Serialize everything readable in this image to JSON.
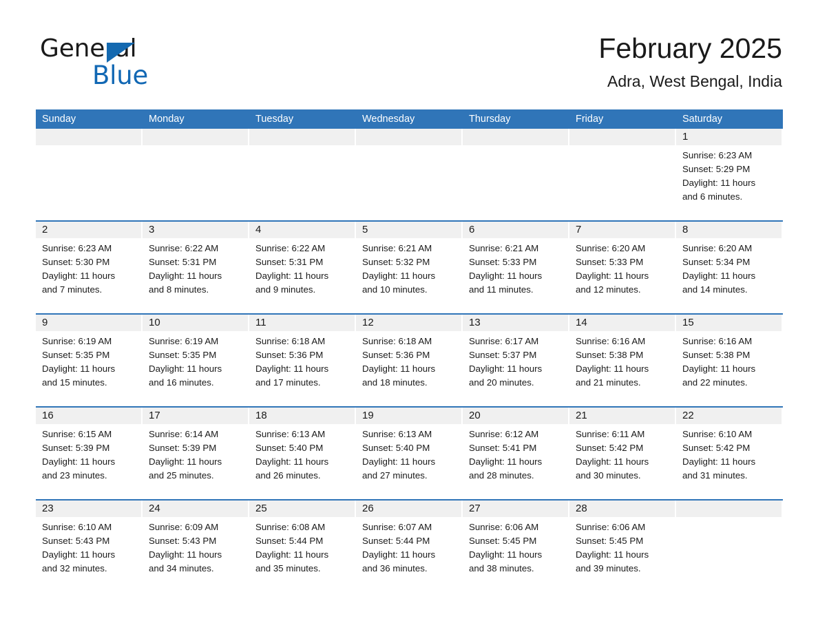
{
  "brand": {
    "name_part1": "General",
    "name_part2": "Blue",
    "accent_color": "#1268b4",
    "triangle_icon": "triangle-icon"
  },
  "header": {
    "title": "February 2025",
    "subtitle": "Adra, West Bengal, India"
  },
  "theme": {
    "header_blue": "#3075b8",
    "date_band_gray": "#f0f0f0",
    "text_color": "#1a1a1a"
  },
  "weekdays": [
    "Sunday",
    "Monday",
    "Tuesday",
    "Wednesday",
    "Thursday",
    "Friday",
    "Saturday"
  ],
  "labels": {
    "sunrise_prefix": "Sunrise:",
    "sunset_prefix": "Sunset:",
    "daylight_prefix": "Daylight:"
  },
  "weeks": [
    [
      {
        "date": "",
        "empty": true
      },
      {
        "date": "",
        "empty": true
      },
      {
        "date": "",
        "empty": true
      },
      {
        "date": "",
        "empty": true
      },
      {
        "date": "",
        "empty": true
      },
      {
        "date": "",
        "empty": true
      },
      {
        "date": "1",
        "sunrise": "Sunrise: 6:23 AM",
        "sunset": "Sunset: 5:29 PM",
        "daylight_line1": "Daylight: 11 hours",
        "daylight_line2": "and 6 minutes."
      }
    ],
    [
      {
        "date": "2",
        "sunrise": "Sunrise: 6:23 AM",
        "sunset": "Sunset: 5:30 PM",
        "daylight_line1": "Daylight: 11 hours",
        "daylight_line2": "and 7 minutes."
      },
      {
        "date": "3",
        "sunrise": "Sunrise: 6:22 AM",
        "sunset": "Sunset: 5:31 PM",
        "daylight_line1": "Daylight: 11 hours",
        "daylight_line2": "and 8 minutes."
      },
      {
        "date": "4",
        "sunrise": "Sunrise: 6:22 AM",
        "sunset": "Sunset: 5:31 PM",
        "daylight_line1": "Daylight: 11 hours",
        "daylight_line2": "and 9 minutes."
      },
      {
        "date": "5",
        "sunrise": "Sunrise: 6:21 AM",
        "sunset": "Sunset: 5:32 PM",
        "daylight_line1": "Daylight: 11 hours",
        "daylight_line2": "and 10 minutes."
      },
      {
        "date": "6",
        "sunrise": "Sunrise: 6:21 AM",
        "sunset": "Sunset: 5:33 PM",
        "daylight_line1": "Daylight: 11 hours",
        "daylight_line2": "and 11 minutes."
      },
      {
        "date": "7",
        "sunrise": "Sunrise: 6:20 AM",
        "sunset": "Sunset: 5:33 PM",
        "daylight_line1": "Daylight: 11 hours",
        "daylight_line2": "and 12 minutes."
      },
      {
        "date": "8",
        "sunrise": "Sunrise: 6:20 AM",
        "sunset": "Sunset: 5:34 PM",
        "daylight_line1": "Daylight: 11 hours",
        "daylight_line2": "and 14 minutes."
      }
    ],
    [
      {
        "date": "9",
        "sunrise": "Sunrise: 6:19 AM",
        "sunset": "Sunset: 5:35 PM",
        "daylight_line1": "Daylight: 11 hours",
        "daylight_line2": "and 15 minutes."
      },
      {
        "date": "10",
        "sunrise": "Sunrise: 6:19 AM",
        "sunset": "Sunset: 5:35 PM",
        "daylight_line1": "Daylight: 11 hours",
        "daylight_line2": "and 16 minutes."
      },
      {
        "date": "11",
        "sunrise": "Sunrise: 6:18 AM",
        "sunset": "Sunset: 5:36 PM",
        "daylight_line1": "Daylight: 11 hours",
        "daylight_line2": "and 17 minutes."
      },
      {
        "date": "12",
        "sunrise": "Sunrise: 6:18 AM",
        "sunset": "Sunset: 5:36 PM",
        "daylight_line1": "Daylight: 11 hours",
        "daylight_line2": "and 18 minutes."
      },
      {
        "date": "13",
        "sunrise": "Sunrise: 6:17 AM",
        "sunset": "Sunset: 5:37 PM",
        "daylight_line1": "Daylight: 11 hours",
        "daylight_line2": "and 20 minutes."
      },
      {
        "date": "14",
        "sunrise": "Sunrise: 6:16 AM",
        "sunset": "Sunset: 5:38 PM",
        "daylight_line1": "Daylight: 11 hours",
        "daylight_line2": "and 21 minutes."
      },
      {
        "date": "15",
        "sunrise": "Sunrise: 6:16 AM",
        "sunset": "Sunset: 5:38 PM",
        "daylight_line1": "Daylight: 11 hours",
        "daylight_line2": "and 22 minutes."
      }
    ],
    [
      {
        "date": "16",
        "sunrise": "Sunrise: 6:15 AM",
        "sunset": "Sunset: 5:39 PM",
        "daylight_line1": "Daylight: 11 hours",
        "daylight_line2": "and 23 minutes."
      },
      {
        "date": "17",
        "sunrise": "Sunrise: 6:14 AM",
        "sunset": "Sunset: 5:39 PM",
        "daylight_line1": "Daylight: 11 hours",
        "daylight_line2": "and 25 minutes."
      },
      {
        "date": "18",
        "sunrise": "Sunrise: 6:13 AM",
        "sunset": "Sunset: 5:40 PM",
        "daylight_line1": "Daylight: 11 hours",
        "daylight_line2": "and 26 minutes."
      },
      {
        "date": "19",
        "sunrise": "Sunrise: 6:13 AM",
        "sunset": "Sunset: 5:40 PM",
        "daylight_line1": "Daylight: 11 hours",
        "daylight_line2": "and 27 minutes."
      },
      {
        "date": "20",
        "sunrise": "Sunrise: 6:12 AM",
        "sunset": "Sunset: 5:41 PM",
        "daylight_line1": "Daylight: 11 hours",
        "daylight_line2": "and 28 minutes."
      },
      {
        "date": "21",
        "sunrise": "Sunrise: 6:11 AM",
        "sunset": "Sunset: 5:42 PM",
        "daylight_line1": "Daylight: 11 hours",
        "daylight_line2": "and 30 minutes."
      },
      {
        "date": "22",
        "sunrise": "Sunrise: 6:10 AM",
        "sunset": "Sunset: 5:42 PM",
        "daylight_line1": "Daylight: 11 hours",
        "daylight_line2": "and 31 minutes."
      }
    ],
    [
      {
        "date": "23",
        "sunrise": "Sunrise: 6:10 AM",
        "sunset": "Sunset: 5:43 PM",
        "daylight_line1": "Daylight: 11 hours",
        "daylight_line2": "and 32 minutes."
      },
      {
        "date": "24",
        "sunrise": "Sunrise: 6:09 AM",
        "sunset": "Sunset: 5:43 PM",
        "daylight_line1": "Daylight: 11 hours",
        "daylight_line2": "and 34 minutes."
      },
      {
        "date": "25",
        "sunrise": "Sunrise: 6:08 AM",
        "sunset": "Sunset: 5:44 PM",
        "daylight_line1": "Daylight: 11 hours",
        "daylight_line2": "and 35 minutes."
      },
      {
        "date": "26",
        "sunrise": "Sunrise: 6:07 AM",
        "sunset": "Sunset: 5:44 PM",
        "daylight_line1": "Daylight: 11 hours",
        "daylight_line2": "and 36 minutes."
      },
      {
        "date": "27",
        "sunrise": "Sunrise: 6:06 AM",
        "sunset": "Sunset: 5:45 PM",
        "daylight_line1": "Daylight: 11 hours",
        "daylight_line2": "and 38 minutes."
      },
      {
        "date": "28",
        "sunrise": "Sunrise: 6:06 AM",
        "sunset": "Sunset: 5:45 PM",
        "daylight_line1": "Daylight: 11 hours",
        "daylight_line2": "and 39 minutes."
      },
      {
        "date": "",
        "empty": true
      }
    ]
  ]
}
